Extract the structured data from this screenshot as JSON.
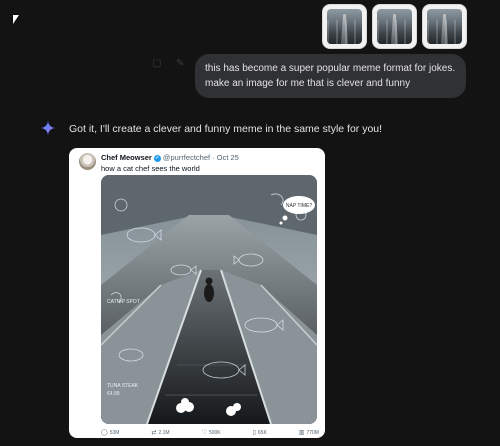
{
  "user_message": {
    "line1": "this has become a super popular meme format for jokes.",
    "line2": "make an image for me that is clever and funny"
  },
  "assistant": {
    "reply": "Got it, I'll create a clever and funny meme in the same style for you!"
  },
  "tweet": {
    "name": "Chef Meowser",
    "handle": "@purrfectchef",
    "date": "· Oct 25",
    "text": "how a cat chef sees the world",
    "image_labels": {
      "nap_time": "NAP TIME?",
      "catnip_spot": "CATNIP SPOT",
      "tuna_steak": "TUNA STEAK",
      "tuna_price": "€4.99"
    },
    "stats": {
      "replies": "53M",
      "retweets": "2.1M",
      "likes": "500K",
      "bookmarks": "65K",
      "views": "770M"
    }
  },
  "icons": [
    "pointer-cursor",
    "sparkle-icon",
    "verified-icon",
    "reply-icon",
    "retweet-icon",
    "like-icon",
    "bookmark-icon",
    "views-icon"
  ]
}
